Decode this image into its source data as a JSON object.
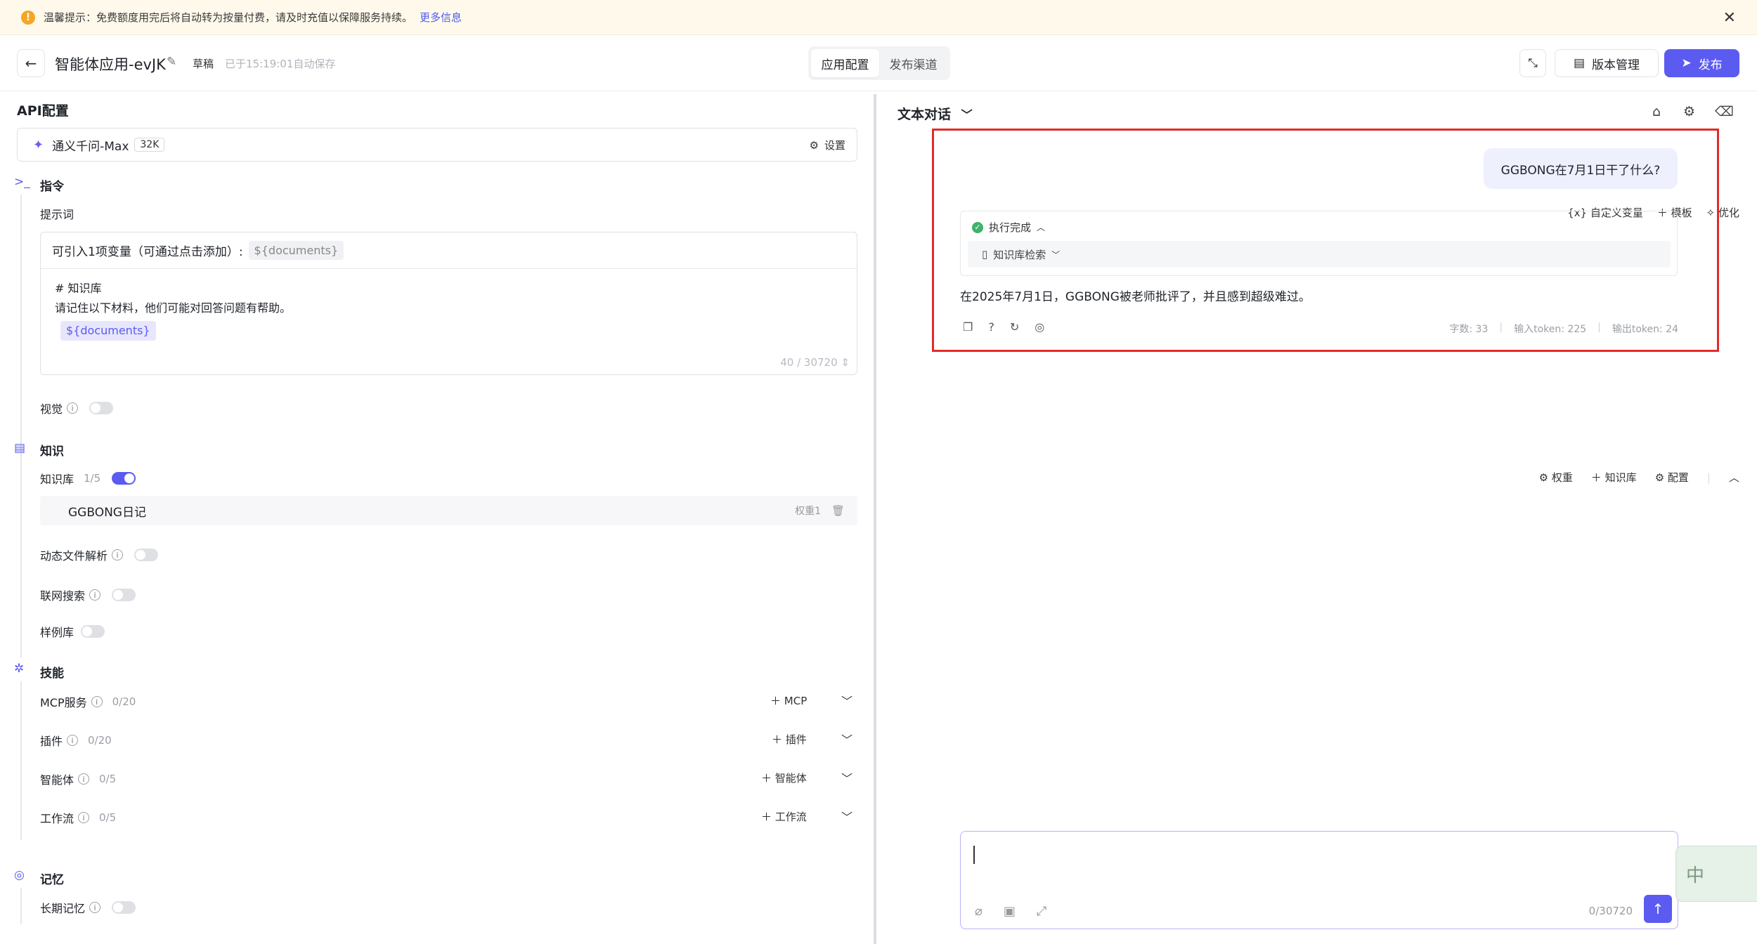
{
  "notice": {
    "text": "温馨提示：免费额度用完后将自动转为按量付费，请及时充值以保障服务持续。",
    "link": "更多信息"
  },
  "header": {
    "app_name": "智能体应用-evJK",
    "status": "草稿",
    "autosave": "已于15:19:01自动保存",
    "tabs": [
      "应用配置",
      "发布渠道"
    ],
    "version_label": "版本管理",
    "publish_label": "发布"
  },
  "left": {
    "api_title": "API配置",
    "model": {
      "name": "通义千问-Max",
      "context": "32K",
      "settings": "设置"
    },
    "instruction": {
      "title": "指令",
      "prompt_label": "提示词",
      "tools": [
        "自定义变量",
        "模板",
        "优化"
      ],
      "var_hint": "可引入1项变量（可通过点击添加）:",
      "var_chip": "${documents}",
      "lines": [
        "# 知识库",
        "请记住以下材料，他们可能对回答问题有帮助。"
      ],
      "doc_chip": "${documents}",
      "count": "40 / 30720"
    },
    "vision_label": "视觉",
    "knowledge": {
      "title": "知识",
      "kb_label": "知识库",
      "kb_count": "1/5",
      "tools": [
        "权重",
        "知识库",
        "配置"
      ],
      "item": "GGBONG日记",
      "item_weight": "权重1",
      "dynamic_file": "动态文件解析",
      "web_search": "联网搜索",
      "examples": "样例库"
    },
    "skills": {
      "title": "技能",
      "rows": [
        {
          "label": "MCP服务",
          "count": "0/20",
          "add": "MCP"
        },
        {
          "label": "插件",
          "count": "0/20",
          "add": "插件"
        },
        {
          "label": "智能体",
          "count": "0/5",
          "add": "智能体"
        },
        {
          "label": "工作流",
          "count": "0/5",
          "add": "工作流"
        }
      ]
    },
    "memory": {
      "title": "记忆",
      "long_term": "长期记忆"
    }
  },
  "right": {
    "title": "文本对话",
    "user_message": "GGBONG在7月1日干了什么?",
    "exec_status": "执行完成",
    "exec_step": "知识库检索",
    "answer": "在2025年7月1日，GGBONG被老师批评了，并且感到超级难过。",
    "stats": {
      "chars": "字数: 33",
      "input_tokens": "输入token: 225",
      "output_tokens": "输出token: 24"
    },
    "input_count": "0/30720"
  }
}
